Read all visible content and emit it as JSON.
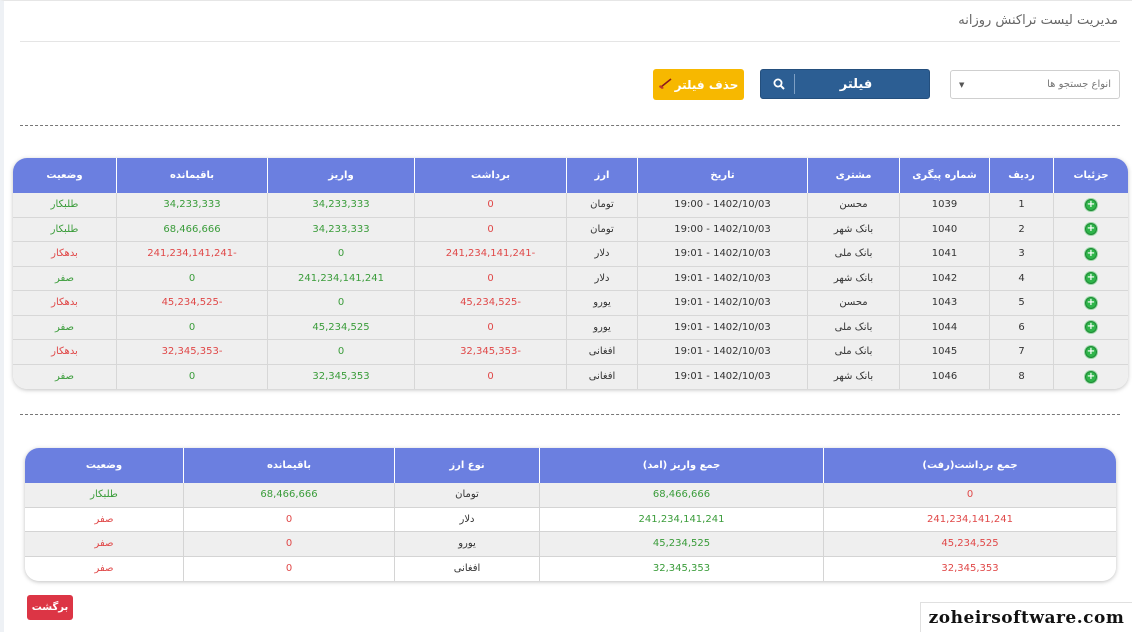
{
  "page": {
    "title": "مدیریت لیست تراکنش روزانه"
  },
  "filters": {
    "search_type_placeholder": "انواع جستجو ها",
    "filter_label": "فیلتر",
    "clear_filter_label": "حذف فیلتر"
  },
  "transactions": {
    "headers": {
      "details": "جزئیات",
      "row": "ردیف",
      "tracking": "شماره پیگری",
      "customer": "مشتری",
      "date": "تاریخ",
      "currency": "ارز",
      "withdraw": "برداشت",
      "deposit": "واریز",
      "balance": "باقیمانده",
      "status": "وضعیت"
    },
    "rows": [
      {
        "row": "1",
        "tracking": "1039",
        "customer": "محسن",
        "date": "1402/10/03 - 19:00",
        "currency": "تومان",
        "withdraw": "0",
        "deposit": "34,233,333",
        "balance": "34,233,333",
        "status": "طلبکار",
        "balance_tone": "green",
        "status_tone": "green"
      },
      {
        "row": "2",
        "tracking": "1040",
        "customer": "بانک شهر",
        "date": "1402/10/03 - 19:00",
        "currency": "تومان",
        "withdraw": "0",
        "deposit": "34,233,333",
        "balance": "68,466,666",
        "status": "طلبکار",
        "balance_tone": "green",
        "status_tone": "green"
      },
      {
        "row": "3",
        "tracking": "1041",
        "customer": "بانک ملی",
        "date": "1402/10/03 - 19:01",
        "currency": "دلار",
        "withdraw": "-241,234,141,241",
        "deposit": "0",
        "balance": "-241,234,141,241",
        "status": "بدهکار",
        "balance_tone": "red",
        "status_tone": "red"
      },
      {
        "row": "4",
        "tracking": "1042",
        "customer": "بانک شهر",
        "date": "1402/10/03 - 19:01",
        "currency": "دلار",
        "withdraw": "0",
        "deposit": "241,234,141,241",
        "balance": "0",
        "status": "صفر",
        "balance_tone": "green",
        "status_tone": "green"
      },
      {
        "row": "5",
        "tracking": "1043",
        "customer": "محسن",
        "date": "1402/10/03 - 19:01",
        "currency": "یورو",
        "withdraw": "-45,234,525",
        "deposit": "0",
        "balance": "-45,234,525",
        "status": "بدهکار",
        "balance_tone": "red",
        "status_tone": "red"
      },
      {
        "row": "6",
        "tracking": "1044",
        "customer": "بانک ملی",
        "date": "1402/10/03 - 19:01",
        "currency": "یورو",
        "withdraw": "0",
        "deposit": "45,234,525",
        "balance": "0",
        "status": "صفر",
        "balance_tone": "green",
        "status_tone": "green"
      },
      {
        "row": "7",
        "tracking": "1045",
        "customer": "بانک ملی",
        "date": "1402/10/03 - 19:01",
        "currency": "افغانی",
        "withdraw": "-32,345,353",
        "deposit": "0",
        "balance": "-32,345,353",
        "status": "بدهکار",
        "balance_tone": "red",
        "status_tone": "red"
      },
      {
        "row": "8",
        "tracking": "1046",
        "customer": "بانک شهر",
        "date": "1402/10/03 - 19:01",
        "currency": "افغانی",
        "withdraw": "0",
        "deposit": "32,345,353",
        "balance": "0",
        "status": "صفر",
        "balance_tone": "green",
        "status_tone": "green"
      }
    ]
  },
  "summary": {
    "headers": {
      "withdraw_total": "جمع برداشت(رفت)",
      "deposit_total": "جمع واریز (امد)",
      "currency_type": "نوع ارز",
      "balance": "باقیمانده",
      "status": "وضعیت"
    },
    "rows": [
      {
        "withdraw_total": "0",
        "deposit_total": "68,466,666",
        "currency_type": "تومان",
        "balance": "68,466,666",
        "status": "طلبکار",
        "balance_tone": "green",
        "status_tone": "green"
      },
      {
        "withdraw_total": "241,234,141,241",
        "deposit_total": "241,234,141,241",
        "currency_type": "دلار",
        "balance": "0",
        "status": "صفر",
        "balance_tone": "red",
        "status_tone": "red"
      },
      {
        "withdraw_total": "45,234,525",
        "deposit_total": "45,234,525",
        "currency_type": "یورو",
        "balance": "0",
        "status": "صفر",
        "balance_tone": "red",
        "status_tone": "red"
      },
      {
        "withdraw_total": "32,345,353",
        "deposit_total": "32,345,353",
        "currency_type": "افغانی",
        "balance": "0",
        "status": "صفر",
        "balance_tone": "red",
        "status_tone": "red"
      }
    ]
  },
  "back_label": "برگشت",
  "watermark": "zoheirsoftware.com",
  "icons": {
    "filter": "search-icon",
    "clear": "broom-icon",
    "details": "plus-circle-icon"
  },
  "colors": {
    "header": "#6b7fe0",
    "filter_button": "#2c5e93",
    "clear_button": "#f7b800",
    "back_button": "#dc3545",
    "positive": "#3a9c3a",
    "negative": "#e04848"
  }
}
